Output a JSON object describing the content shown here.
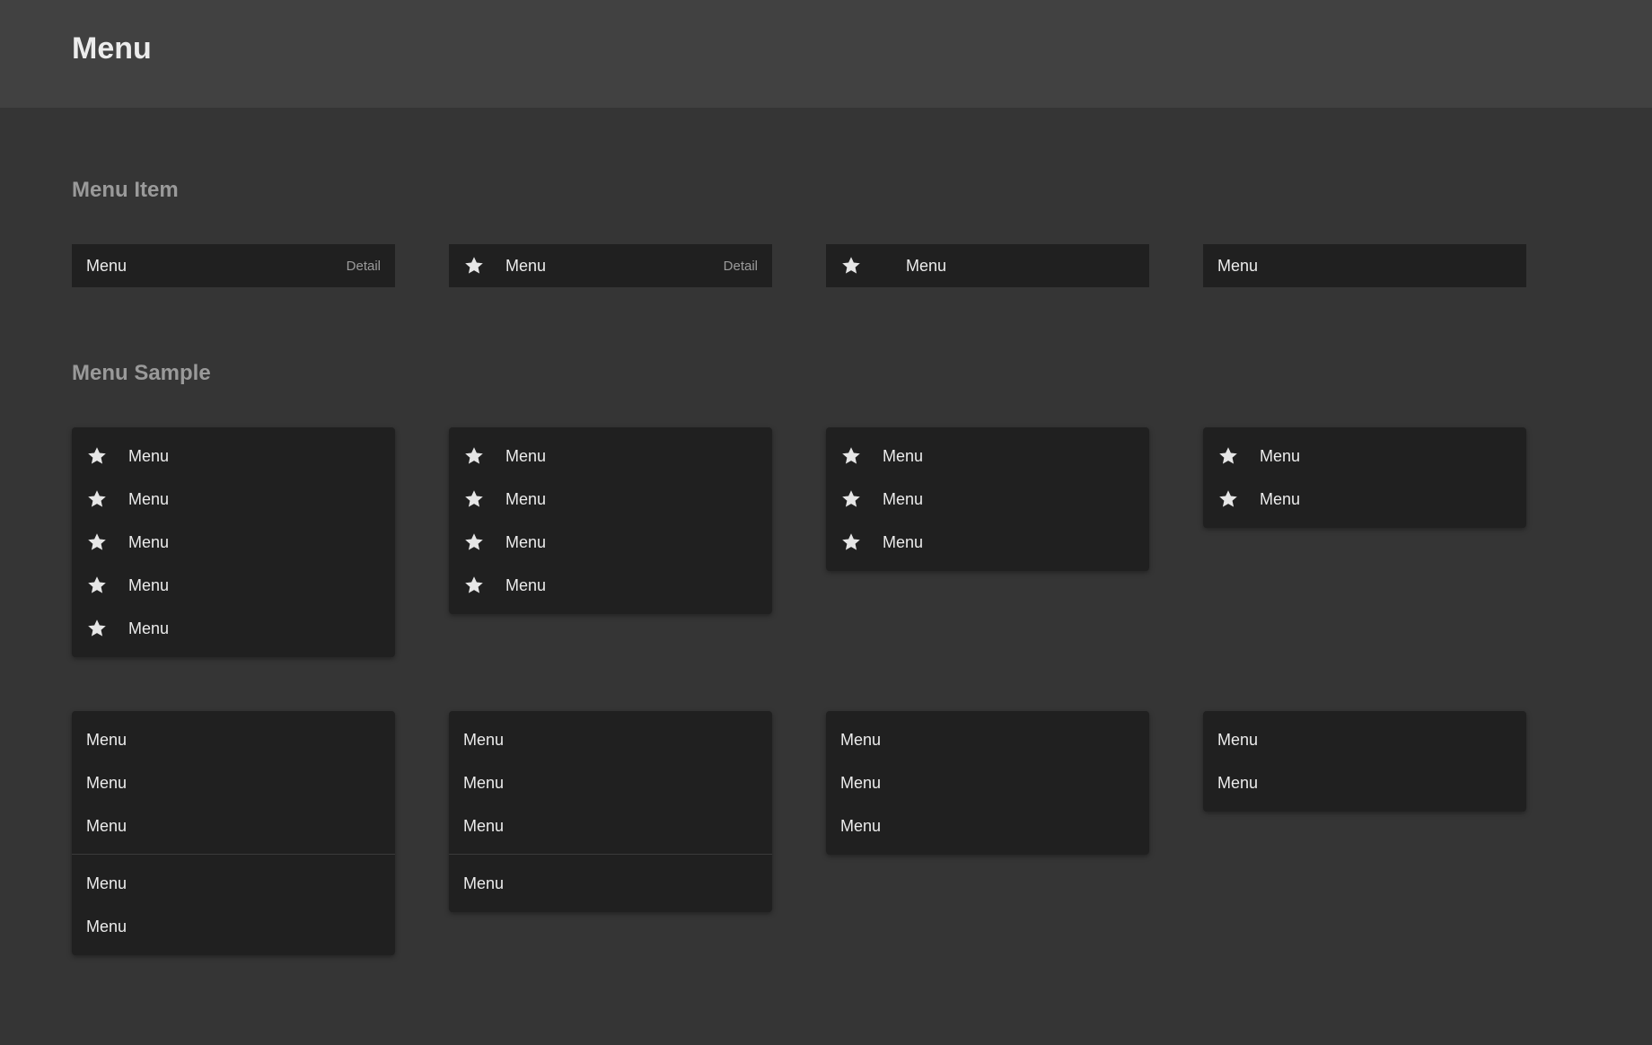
{
  "header": {
    "title": "Menu"
  },
  "sections": {
    "menu_item": "Menu Item",
    "menu_sample": "Menu Sample"
  },
  "menu_items": [
    {
      "label": "Menu",
      "detail": "Detail",
      "icon": "star-icon"
    },
    {
      "label": "Menu",
      "detail": "Detail",
      "icon": "star-icon"
    },
    {
      "label": "Menu",
      "icon": "star-icon"
    },
    {
      "label": "Menu"
    }
  ],
  "icon_menus": [
    {
      "items": [
        "Menu",
        "Menu",
        "Menu",
        "Menu",
        "Menu"
      ]
    },
    {
      "items": [
        "Menu",
        "Menu",
        "Menu",
        "Menu"
      ]
    },
    {
      "items": [
        "Menu",
        "Menu",
        "Menu"
      ]
    },
    {
      "items": [
        "Menu",
        "Menu"
      ]
    }
  ],
  "text_menus": [
    {
      "groups": [
        [
          "Menu",
          "Menu",
          "Menu"
        ],
        [
          "Menu",
          "Menu"
        ]
      ]
    },
    {
      "groups": [
        [
          "Menu",
          "Menu",
          "Menu"
        ],
        [
          "Menu"
        ]
      ]
    },
    {
      "groups": [
        [
          "Menu",
          "Menu",
          "Menu"
        ]
      ]
    },
    {
      "groups": [
        [
          "Menu",
          "Menu"
        ]
      ]
    }
  ],
  "colors": {
    "background": "#353535",
    "header": "#414141",
    "surface": "#202020",
    "text": "#ececec",
    "muted": "#9b9b9b"
  }
}
